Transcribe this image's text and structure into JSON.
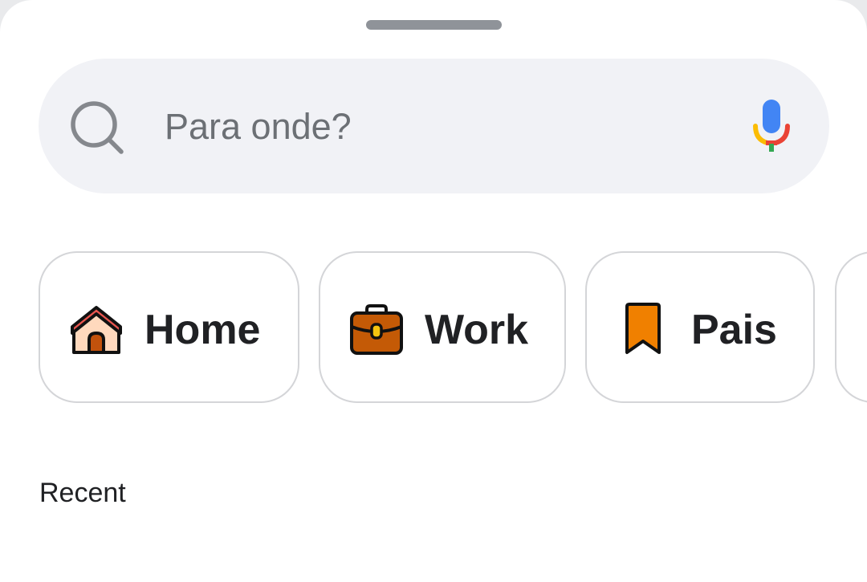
{
  "search": {
    "placeholder": "Para onde?",
    "search_icon": "search-icon",
    "voice_icon": "microphone-icon"
  },
  "shortcuts": [
    {
      "label": "Home",
      "icon": "home-icon"
    },
    {
      "label": "Work",
      "icon": "briefcase-icon"
    },
    {
      "label": "Pais",
      "icon": "bookmark-icon"
    }
  ],
  "recent": {
    "title": "Recent"
  },
  "colors": {
    "sheet_background": "#ffffff",
    "search_background": "#f1f2f6",
    "chip_border": "#d4d5d8",
    "text_primary": "#202124",
    "placeholder_text": "#6c7075",
    "handle": "#8f9399",
    "home_roof": "#e8564f",
    "home_body": "#ffd9bd",
    "home_door": "#c2520c",
    "work_case": "#c45a06",
    "work_clasp": "#f5c40f",
    "pais_bookmark": "#f08000",
    "mic_blue": "#4285f4",
    "mic_red": "#ea4335",
    "mic_yellow": "#fbbc04",
    "mic_green": "#34a853"
  }
}
